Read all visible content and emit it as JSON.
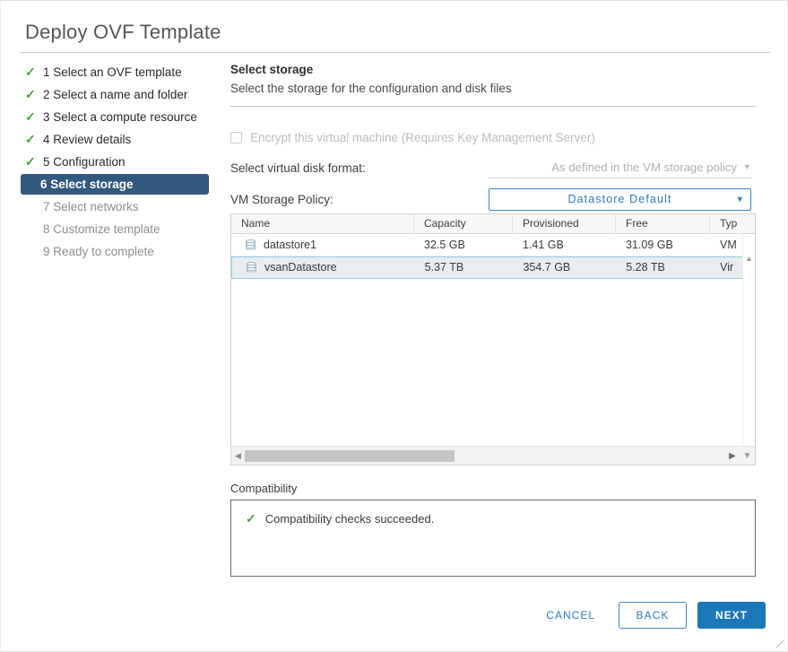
{
  "dialog": {
    "title": "Deploy OVF Template"
  },
  "steps": [
    {
      "label": "1 Select an OVF template",
      "state": "done",
      "tick": "check-icon"
    },
    {
      "label": "2 Select a name and folder",
      "state": "done",
      "tick": "check-icon"
    },
    {
      "label": "3 Select a compute resource",
      "state": "done",
      "tick": "check-icon"
    },
    {
      "label": "4 Review details",
      "state": "done",
      "tick": "check-icon"
    },
    {
      "label": "5 Configuration",
      "state": "done",
      "tick": "check-icon"
    },
    {
      "label": "6 Select storage",
      "state": "active",
      "tick": ""
    },
    {
      "label": "7 Select networks",
      "state": "pending",
      "tick": ""
    },
    {
      "label": "8 Customize template",
      "state": "pending",
      "tick": ""
    },
    {
      "label": "9 Ready to complete",
      "state": "pending",
      "tick": ""
    }
  ],
  "pane": {
    "heading": "Select storage",
    "subheading": "Select the storage for the configuration and disk files"
  },
  "encrypt": {
    "label": "Encrypt this virtual machine (Requires Key Management Server)",
    "checked": false,
    "disabled": true
  },
  "disk_format": {
    "label": "Select virtual disk format:",
    "value": "As defined in the VM storage policy",
    "caret": "chevron-down-icon",
    "disabled": true
  },
  "storage_policy": {
    "label": "VM Storage Policy:",
    "value": "Datastore Default",
    "caret": "chevron-down-icon"
  },
  "table": {
    "columns": [
      "Name",
      "Capacity",
      "Provisioned",
      "Free",
      "Typ"
    ],
    "rows": [
      {
        "name": "datastore1",
        "capacity": "32.5 GB",
        "provisioned": "1.41 GB",
        "free": "31.09 GB",
        "type": "VM",
        "selected": false,
        "icon": "datastore-icon"
      },
      {
        "name": "vsanDatastore",
        "capacity": "5.37 TB",
        "provisioned": "354.7 GB",
        "free": "5.28 TB",
        "type": "Vir",
        "selected": true,
        "icon": "datastore-icon"
      }
    ],
    "scroll": {
      "vertical_up": "caret-up-icon",
      "horizontal_left": "caret-left-icon",
      "horizontal_right": "caret-right-icon",
      "horizontal_down": "caret-down-icon"
    }
  },
  "compatibility": {
    "label": "Compatibility",
    "message": "Compatibility checks succeeded.",
    "status_icon": "check-icon"
  },
  "footer": {
    "cancel": "CANCEL",
    "back": "BACK",
    "next": "NEXT"
  },
  "colors": {
    "active_step_bg": "#31597f",
    "primary_button": "#1b78b8",
    "link_blue": "#2f7bb8",
    "success_green": "#4aa13f",
    "selected_row_border": "#8fd3e8"
  }
}
